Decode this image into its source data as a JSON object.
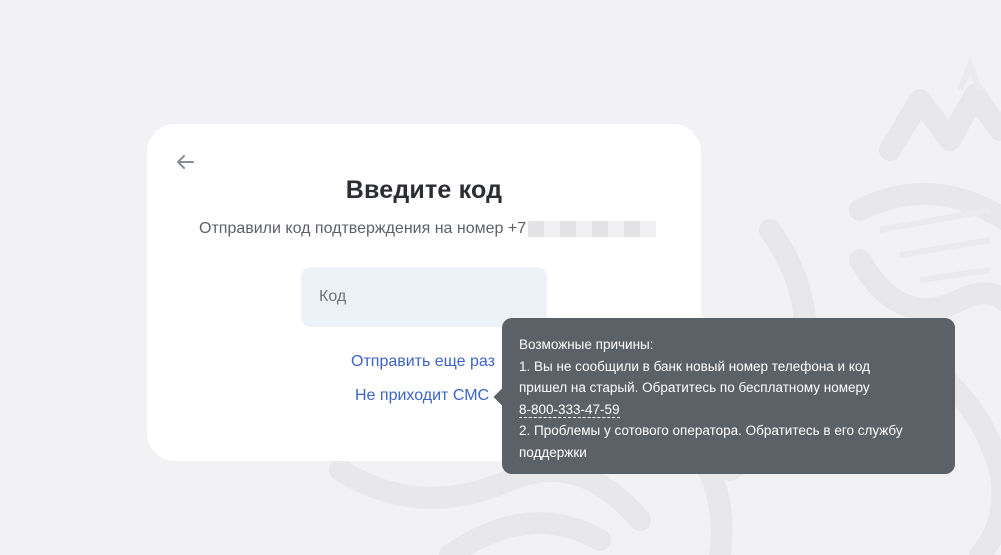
{
  "card": {
    "title": "Введите код",
    "subtitle": "Отправили код подтверждения на номер +7",
    "code_placeholder": "Код",
    "resend_label": "Отправить еще раз",
    "no_sms_label": "Не приходит СМС"
  },
  "tooltip": {
    "heading": "Возможные причины:",
    "reason1_line1": "1. Вы не сообщили в банк новый номер телефона и код",
    "reason1_line2": "пришел на старый. Обратитесь по бесплатному номеру",
    "phone": "8-800-333-47-59",
    "reason2_line1": "2. Проблемы у сотового оператора. Обратитесь в его службу",
    "reason2_line2": "поддержки"
  },
  "icons": {
    "back": "arrow-left-icon"
  },
  "colors": {
    "background": "#f2f2f4",
    "card": "#ffffff",
    "link": "#3d63c8",
    "input_bg": "#edf1f8",
    "tooltip_bg": "#5c6168",
    "title": "#2b2d33"
  }
}
